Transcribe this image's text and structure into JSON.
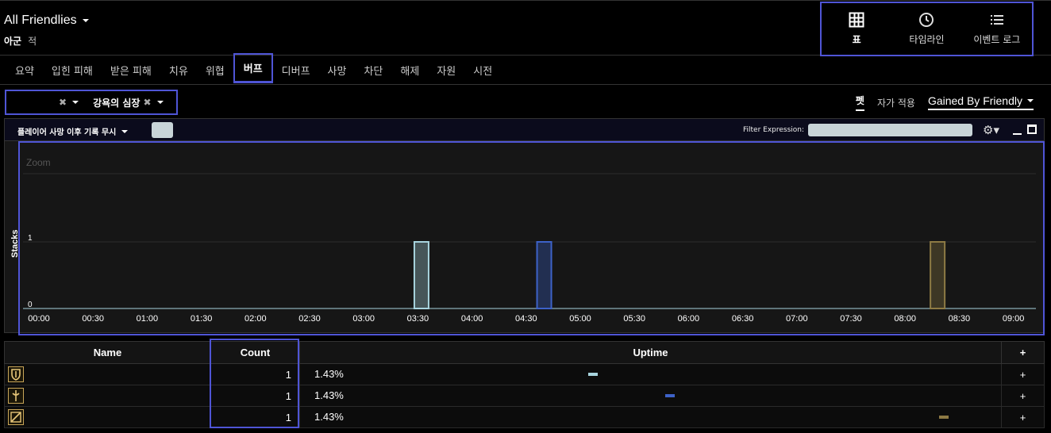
{
  "header": {
    "title": "All Friendlies",
    "sub_active": "아군",
    "sub_inactive": "적"
  },
  "views": [
    {
      "label": "표",
      "icon": "grid-icon"
    },
    {
      "label": "타임라인",
      "icon": "clock-icon"
    },
    {
      "label": "이벤트 로그",
      "icon": "list-icon"
    }
  ],
  "tabs": [
    "요약",
    "입힌 피해",
    "받은 피해",
    "치유",
    "위협",
    "버프",
    "디버프",
    "사망",
    "차단",
    "해제",
    "자원",
    "시전"
  ],
  "selected_tab": "버프",
  "filters": {
    "pill2": "강욕의 심장",
    "pet_label": "펫",
    "auto_label": "자가 적용",
    "gained_label": "Gained By Friendly"
  },
  "chart_toolbar": {
    "death_filter": "플레이어 사망 이후 기록 무시",
    "filter_label": "Filter Expression:"
  },
  "chart_data": {
    "type": "bar",
    "zoom_label": "Zoom",
    "ylabel": "Stacks",
    "y_ticks": [
      "0",
      "1"
    ],
    "x_ticks": [
      "00:00",
      "00:30",
      "01:00",
      "01:30",
      "02:00",
      "02:30",
      "03:00",
      "03:30",
      "04:00",
      "04:30",
      "05:00",
      "05:30",
      "06:00",
      "06:30",
      "07:00",
      "07:30",
      "08:00",
      "08:30",
      "09:00"
    ],
    "ylim": [
      0,
      1
    ],
    "bars": [
      {
        "x_seconds": 212,
        "value": 1,
        "color": "#a8d4de"
      },
      {
        "x_seconds": 280,
        "value": 1,
        "color": "#3d62c8"
      },
      {
        "x_seconds": 498,
        "value": 1,
        "color": "#8d7a44"
      }
    ]
  },
  "table": {
    "headers": {
      "name": "Name",
      "count": "Count",
      "uptime": "Uptime",
      "plus": "+"
    },
    "rows": [
      {
        "icon": "shield-icon",
        "count": "1",
        "uptime": "1.43%",
        "bar_color": "#a8d4de",
        "bar_pos": 0.41
      },
      {
        "icon": "sword-icon",
        "count": "1",
        "uptime": "1.43%",
        "bar_color": "#3d62c8",
        "bar_pos": 0.52
      },
      {
        "icon": "slash-icon",
        "count": "1",
        "uptime": "1.43%",
        "bar_color": "#8d7a44",
        "bar_pos": 0.91
      }
    ]
  }
}
